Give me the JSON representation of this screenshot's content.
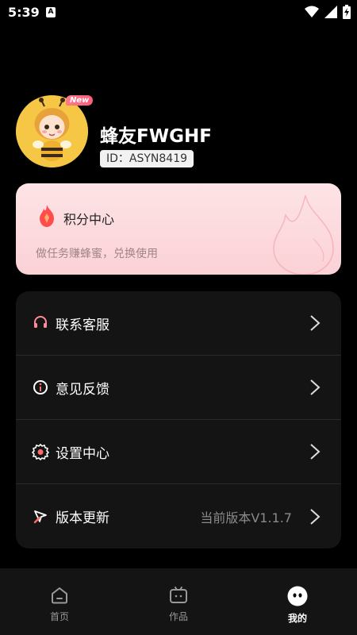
{
  "status_bar": {
    "time": "5:39",
    "notification_letter": "A"
  },
  "profile": {
    "new_badge": "New",
    "username": "蜂友FWGHF",
    "user_id": "ID：ASYN8419"
  },
  "points_card": {
    "title": "积分中心",
    "description": "做任务赚蜂蜜，兑换使用"
  },
  "menu": {
    "items": [
      {
        "label": "联系客服",
        "icon": "headset-icon"
      },
      {
        "label": "意见反馈",
        "icon": "info-icon"
      },
      {
        "label": "设置中心",
        "icon": "gear-icon"
      },
      {
        "label": "版本更新",
        "icon": "rocket-icon",
        "value": "当前版本V1.1.7"
      }
    ]
  },
  "bottom_nav": {
    "items": [
      {
        "label": "首页",
        "icon": "home-icon"
      },
      {
        "label": "作品",
        "icon": "works-icon"
      },
      {
        "label": "我的",
        "icon": "profile-face-icon"
      }
    ],
    "active_index": 2
  },
  "colors": {
    "accent_pink": "#ff5b7a",
    "card_bg": "#141414",
    "points_card_bg": "#fde4e6"
  }
}
